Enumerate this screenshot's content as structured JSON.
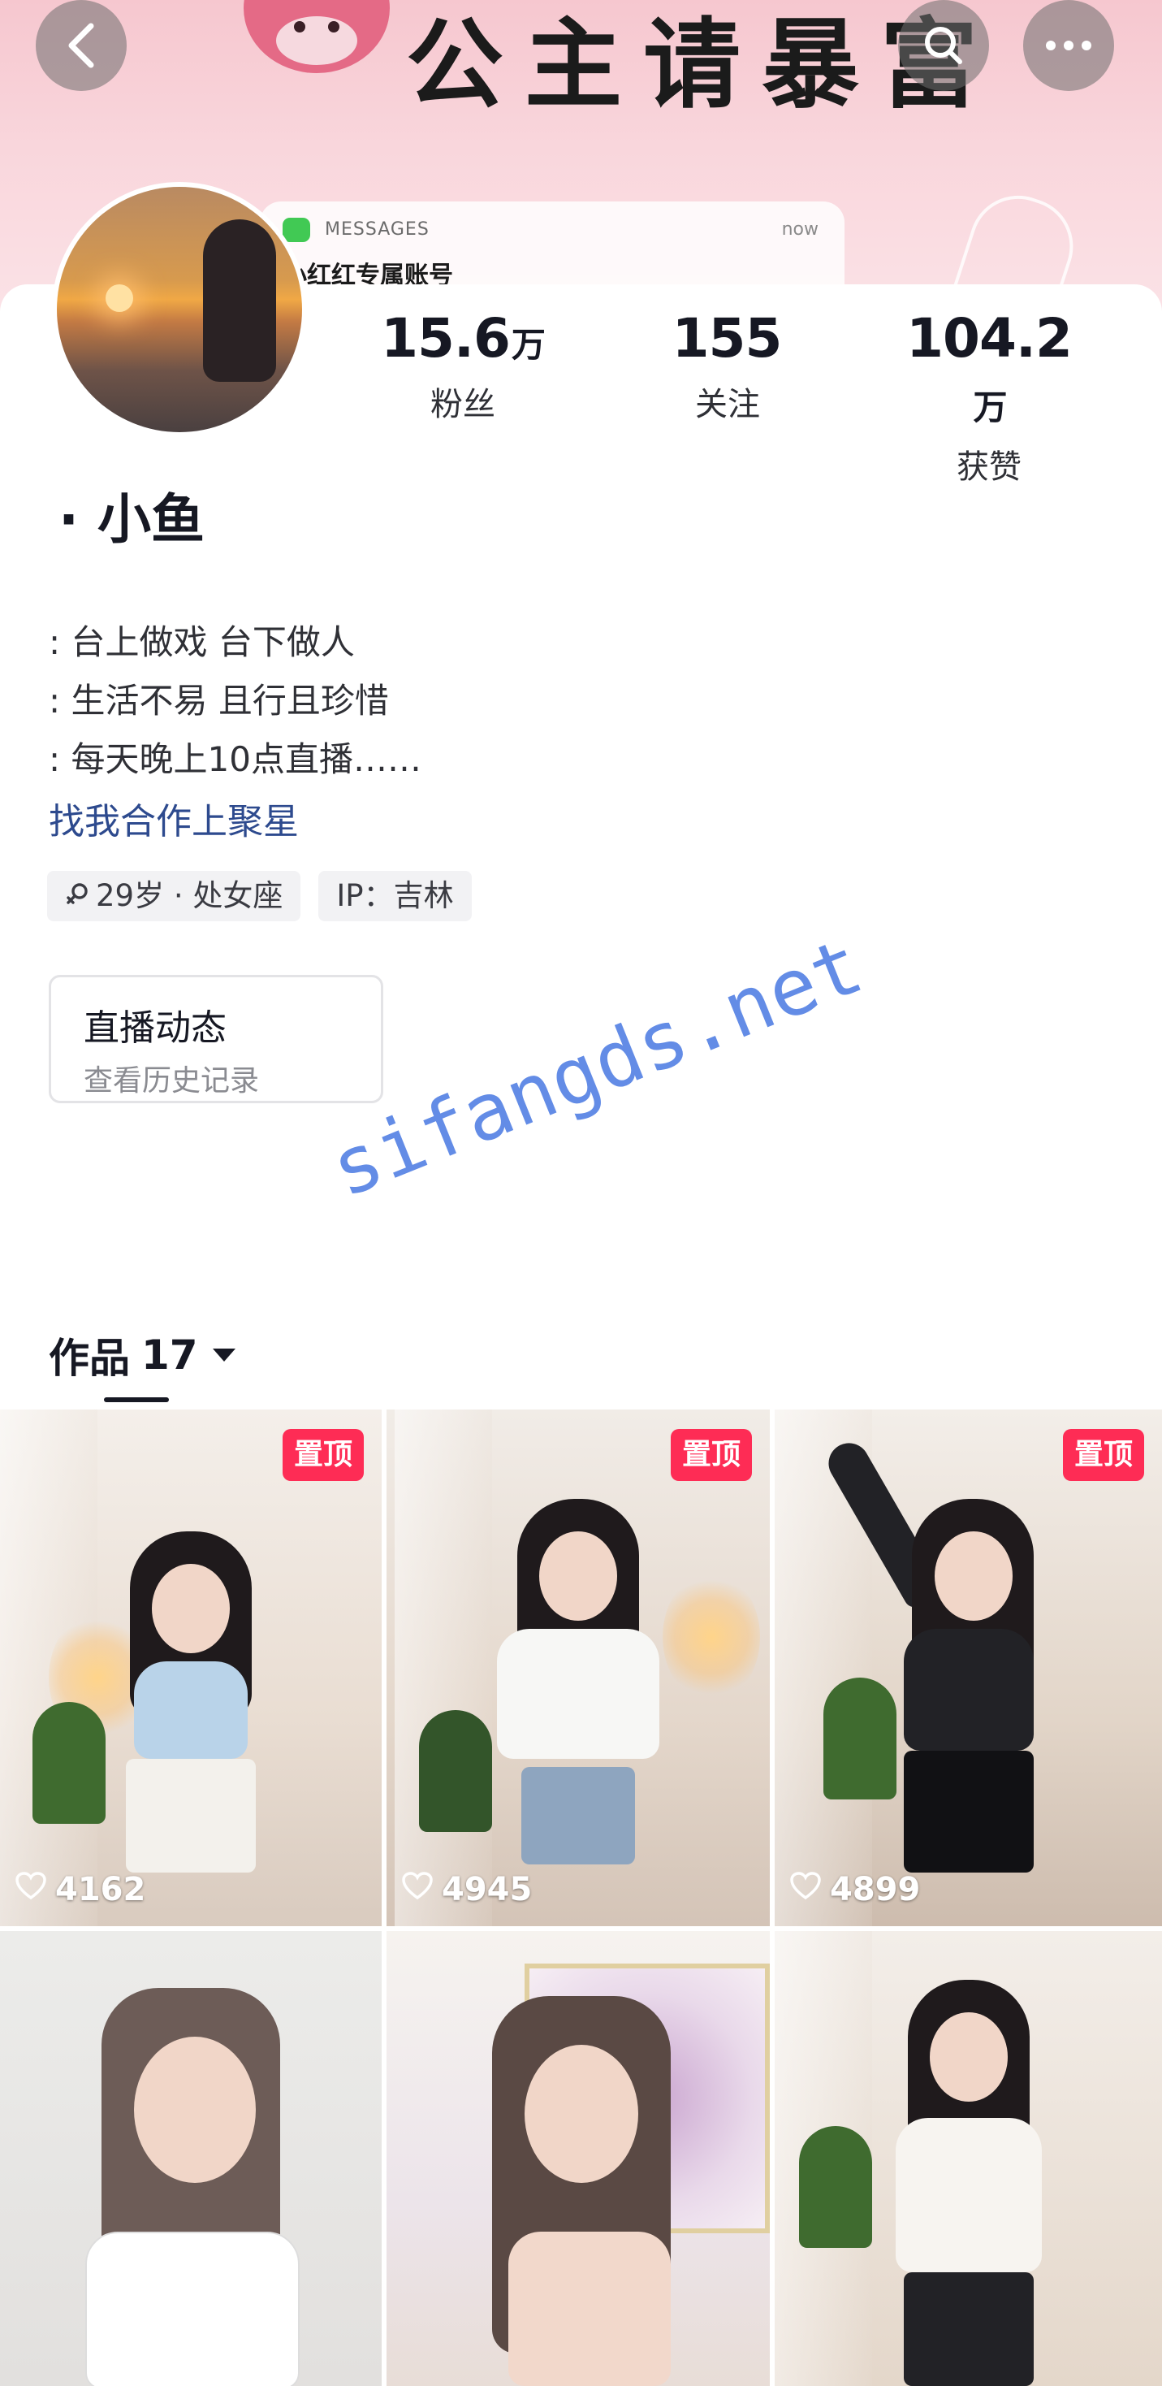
{
  "banner": {
    "title": "公主请暴富",
    "message_app": "MESSAGES",
    "message_time": "now",
    "message_text": "小红红专属账号"
  },
  "topbar": {
    "back_icon": "chevron-left-icon",
    "search_icon": "search-icon",
    "more_icon": "more-horizontal-icon"
  },
  "profile": {
    "nickname": "· 小鱼",
    "stats": [
      {
        "value": "15.6",
        "unit": "万",
        "label": "粉丝"
      },
      {
        "value": "155",
        "unit": "",
        "label": "关注"
      },
      {
        "value": "104.2",
        "unit": "万",
        "label": "获赞"
      }
    ],
    "bio_lines": [
      ": 台上做戏 台下做人",
      ": 生活不易 且行且珍惜",
      ": 每天晚上10点直播……"
    ],
    "bio_link": "找我合作上聚星",
    "tags": [
      "29岁 · 处女座",
      "IP：吉林"
    ],
    "live_card": {
      "title": "直播动态",
      "subtitle": "查看历史记录"
    }
  },
  "watermark": "sifangds.net",
  "works": {
    "label": "作品",
    "count": "17"
  },
  "videos": [
    {
      "pinned": true,
      "pin_label": "置顶",
      "likes": "4162",
      "top": "#b9d3e9",
      "bottom": "#f3f1ec"
    },
    {
      "pinned": true,
      "pin_label": "置顶",
      "likes": "4945",
      "top": "#f7f7f5",
      "bottom": "#8ea5bf"
    },
    {
      "pinned": true,
      "pin_label": "置顶",
      "likes": "4899",
      "top": "#222226",
      "bottom": "#111114"
    },
    {
      "pinned": false,
      "pin_label": "",
      "likes": "",
      "top": "#e9e6e6",
      "bottom": "#ffffff"
    },
    {
      "pinned": false,
      "pin_label": "",
      "likes": "",
      "top": "#ece4ea",
      "bottom": "#f2ece6"
    },
    {
      "pinned": false,
      "pin_label": "",
      "likes": "",
      "top": "#f7f4f0",
      "bottom": "#222226"
    }
  ]
}
